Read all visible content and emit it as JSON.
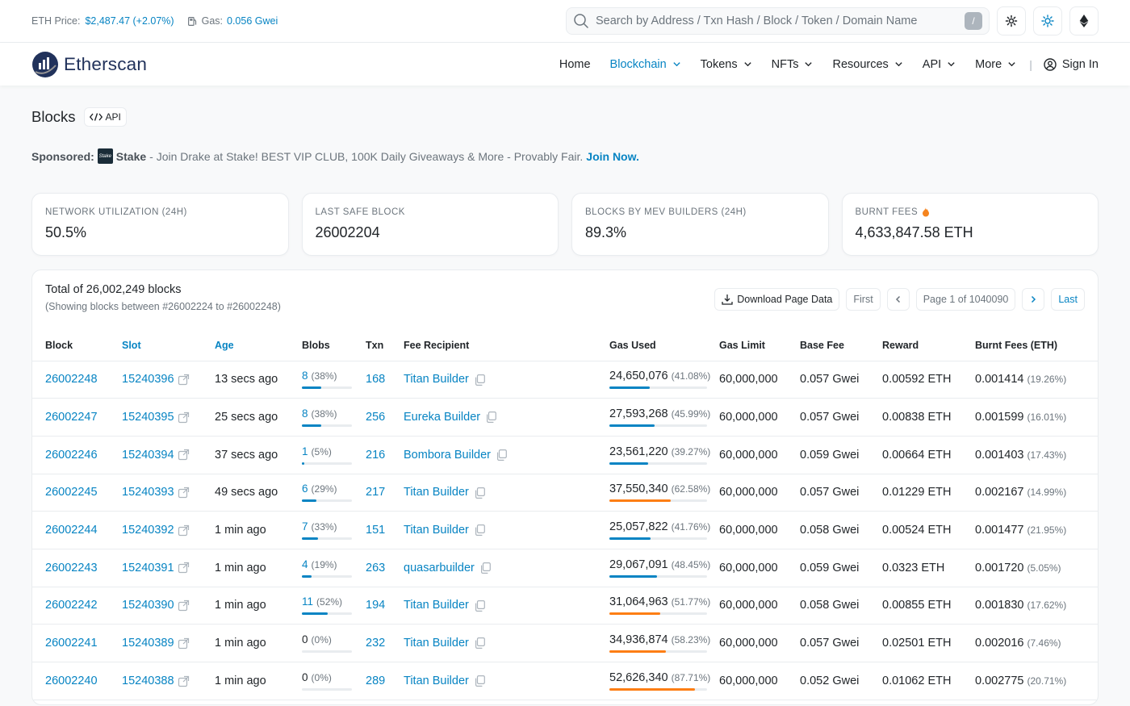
{
  "topbar": {
    "eth_price_label": "ETH Price:",
    "eth_price_value": "$2,487.47 (+2.07%)",
    "gas_label": "Gas:",
    "gas_value": "0.056 Gwei",
    "search_placeholder": "Search by Address / Txn Hash / Block / Token / Domain Name",
    "search_shortcut": "/"
  },
  "nav": {
    "logo": "Etherscan",
    "items": [
      {
        "label": "Home",
        "active": false,
        "dropdown": false
      },
      {
        "label": "Blockchain",
        "active": true,
        "dropdown": true
      },
      {
        "label": "Tokens",
        "active": false,
        "dropdown": true
      },
      {
        "label": "NFTs",
        "active": false,
        "dropdown": true
      },
      {
        "label": "Resources",
        "active": false,
        "dropdown": true
      },
      {
        "label": "API",
        "active": false,
        "dropdown": true
      },
      {
        "label": "More",
        "active": false,
        "dropdown": true
      }
    ],
    "separator": "|",
    "signin": "Sign In"
  },
  "page": {
    "title": "Blocks",
    "api_badge": "API"
  },
  "sponsor": {
    "label": "Sponsored:",
    "brand": "Stake",
    "text": " - Join Drake at Stake! BEST VIP CLUB, 100K Daily Giveaways & More - Provably Fair.",
    "cta": "Join Now."
  },
  "stats": [
    {
      "label": "NETWORK UTILIZATION (24H)",
      "value": "50.5%"
    },
    {
      "label": "LAST SAFE BLOCK",
      "value": "26002204"
    },
    {
      "label": "BLOCKS BY MEV BUILDERS (24H)",
      "value": "89.3%"
    },
    {
      "label": "BURNT FEES",
      "value": "4,633,847.58 ETH",
      "icon": "fire-icon"
    }
  ],
  "table_header": {
    "total": "Total of 26,002,249 blocks",
    "showing": "(Showing blocks between #26002224 to #26002248)",
    "download": "Download Page Data",
    "first": "First",
    "page": "Page 1 of 1040090",
    "last": "Last"
  },
  "columns": [
    "Block",
    "Slot",
    "Age",
    "Blobs",
    "Txn",
    "Fee Recipient",
    "Gas Used",
    "Gas Limit",
    "Base Fee",
    "Reward",
    "Burnt Fees (ETH)"
  ],
  "colors": {
    "accent": "#0784c3",
    "gas_high": "#fd7e14",
    "fire": "#f5841f"
  },
  "rows": [
    {
      "block": "26002248",
      "slot": "15240396",
      "age": "13 secs ago",
      "blobs": "8",
      "blobs_pct": "(38%)",
      "blobs_frac": 0.38,
      "txn": "168",
      "recipient": "Titan Builder",
      "gas_used": "24,650,076",
      "gas_pct": "(41.08%)",
      "gas_frac": 0.4108,
      "gas_limit": "60,000,000",
      "base_fee": "0.057 Gwei",
      "reward": "0.00592 ETH",
      "burnt": "0.001414",
      "burnt_pct": "(19.26%)"
    },
    {
      "block": "26002247",
      "slot": "15240395",
      "age": "25 secs ago",
      "blobs": "8",
      "blobs_pct": "(38%)",
      "blobs_frac": 0.38,
      "txn": "256",
      "recipient": "Eureka Builder",
      "gas_used": "27,593,268",
      "gas_pct": "(45.99%)",
      "gas_frac": 0.4599,
      "gas_limit": "60,000,000",
      "base_fee": "0.057 Gwei",
      "reward": "0.00838 ETH",
      "burnt": "0.001599",
      "burnt_pct": "(16.01%)"
    },
    {
      "block": "26002246",
      "slot": "15240394",
      "age": "37 secs ago",
      "blobs": "1",
      "blobs_pct": "(5%)",
      "blobs_frac": 0.05,
      "txn": "216",
      "recipient": "Bombora Builder",
      "gas_used": "23,561,220",
      "gas_pct": "(39.27%)",
      "gas_frac": 0.3927,
      "gas_limit": "60,000,000",
      "base_fee": "0.059 Gwei",
      "reward": "0.00664 ETH",
      "burnt": "0.001403",
      "burnt_pct": "(17.43%)"
    },
    {
      "block": "26002245",
      "slot": "15240393",
      "age": "49 secs ago",
      "blobs": "6",
      "blobs_pct": "(29%)",
      "blobs_frac": 0.29,
      "txn": "217",
      "recipient": "Titan Builder",
      "gas_used": "37,550,340",
      "gas_pct": "(62.58%)",
      "gas_frac": 0.6258,
      "gas_limit": "60,000,000",
      "base_fee": "0.057 Gwei",
      "reward": "0.01229 ETH",
      "burnt": "0.002167",
      "burnt_pct": "(14.99%)"
    },
    {
      "block": "26002244",
      "slot": "15240392",
      "age": "1 min ago",
      "blobs": "7",
      "blobs_pct": "(33%)",
      "blobs_frac": 0.33,
      "txn": "151",
      "recipient": "Titan Builder",
      "gas_used": "25,057,822",
      "gas_pct": "(41.76%)",
      "gas_frac": 0.4176,
      "gas_limit": "60,000,000",
      "base_fee": "0.058 Gwei",
      "reward": "0.00524 ETH",
      "burnt": "0.001477",
      "burnt_pct": "(21.95%)"
    },
    {
      "block": "26002243",
      "slot": "15240391",
      "age": "1 min ago",
      "blobs": "4",
      "blobs_pct": "(19%)",
      "blobs_frac": 0.19,
      "txn": "263",
      "recipient": "quasarbuilder",
      "gas_used": "29,067,091",
      "gas_pct": "(48.45%)",
      "gas_frac": 0.4845,
      "gas_limit": "60,000,000",
      "base_fee": "0.059 Gwei",
      "reward": "0.0323 ETH",
      "burnt": "0.001720",
      "burnt_pct": "(5.05%)"
    },
    {
      "block": "26002242",
      "slot": "15240390",
      "age": "1 min ago",
      "blobs": "11",
      "blobs_pct": "(52%)",
      "blobs_frac": 0.52,
      "txn": "194",
      "recipient": "Titan Builder",
      "gas_used": "31,064,963",
      "gas_pct": "(51.77%)",
      "gas_frac": 0.5177,
      "gas_limit": "60,000,000",
      "base_fee": "0.058 Gwei",
      "reward": "0.00855 ETH",
      "burnt": "0.001830",
      "burnt_pct": "(17.62%)"
    },
    {
      "block": "26002241",
      "slot": "15240389",
      "age": "1 min ago",
      "blobs": "0",
      "blobs_pct": "(0%)",
      "blobs_frac": 0,
      "txn": "232",
      "recipient": "Titan Builder",
      "gas_used": "34,936,874",
      "gas_pct": "(58.23%)",
      "gas_frac": 0.5823,
      "gas_limit": "60,000,000",
      "base_fee": "0.057 Gwei",
      "reward": "0.02501 ETH",
      "burnt": "0.002016",
      "burnt_pct": "(7.46%)"
    },
    {
      "block": "26002240",
      "slot": "15240388",
      "age": "1 min ago",
      "blobs": "0",
      "blobs_pct": "(0%)",
      "blobs_frac": 0,
      "txn": "289",
      "recipient": "Titan Builder",
      "gas_used": "52,626,340",
      "gas_pct": "(87.71%)",
      "gas_frac": 0.8771,
      "gas_limit": "60,000,000",
      "base_fee": "0.052 Gwei",
      "reward": "0.01062 ETH",
      "burnt": "0.002775",
      "burnt_pct": "(20.71%)"
    }
  ]
}
